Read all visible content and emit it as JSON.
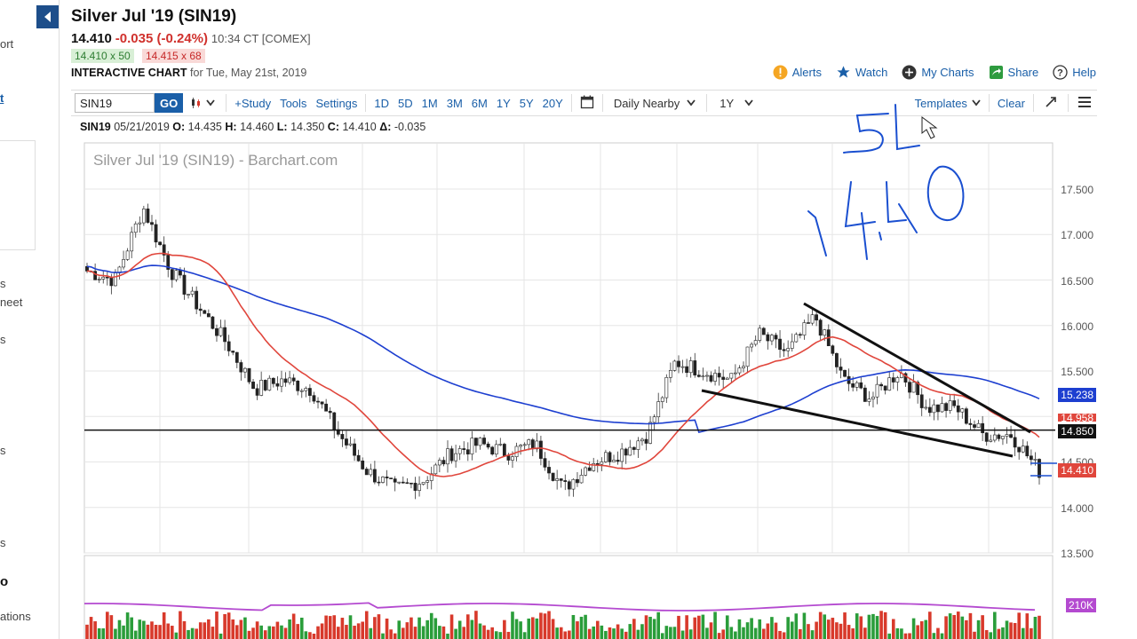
{
  "sidebar": {
    "fragments": [
      "ort",
      "t",
      "s",
      "neet",
      "s",
      "s",
      "s",
      "o",
      "ations"
    ]
  },
  "header": {
    "title": "Silver Jul '19 (SIN19)",
    "last": "14.410",
    "change": "-0.035 (-0.24%)",
    "time": "10:34 CT [COMEX]",
    "bid": "14.410 x 50",
    "ask": "14.415 x 68",
    "interactive_label": "INTERACTIVE CHART",
    "interactive_date": "for Tue, May 21st, 2019"
  },
  "actions": [
    {
      "label": "Alerts",
      "icon": "alert-icon"
    },
    {
      "label": "Watch",
      "icon": "star-icon"
    },
    {
      "label": "My Charts",
      "icon": "plus-circle-icon"
    },
    {
      "label": "Share",
      "icon": "share-icon"
    },
    {
      "label": "Help",
      "icon": "help-icon"
    }
  ],
  "toolbar": {
    "symbol_value": "SIN19",
    "go_label": "GO",
    "study_label": "+Study",
    "tools_label": "Tools",
    "settings_label": "Settings",
    "periods": [
      "1D",
      "5D",
      "1M",
      "3M",
      "6M",
      "1Y",
      "5Y",
      "20Y"
    ],
    "selected_period": "1Y",
    "contract_label": "Daily Nearby",
    "range_label": "1Y",
    "templates_label": "Templates",
    "clear_label": "Clear"
  },
  "ohlc": {
    "symbol": "SIN19",
    "date": "05/21/2019",
    "open_label": "O:",
    "open": "14.435",
    "high_label": "H:",
    "high": "14.460",
    "low_label": "L:",
    "low": "14.350",
    "close_label": "C:",
    "close": "14.410",
    "delta_label": "Δ:",
    "delta": "-0.035"
  },
  "chart": {
    "watermark": "Silver Jul '19 (SIN19) - Barchart.com",
    "y_ticks": [
      "17.500",
      "17.000",
      "16.500",
      "16.000",
      "15.500",
      "14.500",
      "14.000",
      "13.500"
    ],
    "badges": [
      {
        "label": "15.238",
        "color": "#1d3fd0"
      },
      {
        "label": "14.958",
        "color": "#e0463c"
      },
      {
        "label": "14.850",
        "color": "#111111"
      },
      {
        "label": "14.410",
        "color": "#e0463c"
      },
      {
        "label": "210K",
        "color": "#b44ad0"
      }
    ],
    "handwriting": [
      "5L",
      "14.40"
    ],
    "colors": {
      "up": "#2a9d3a",
      "down": "#d8392b",
      "ma_fast": "#e0463c",
      "ma_slow": "#1d3fd0",
      "volume_ma": "#b44ad0",
      "annotation_ink": "#1a4fd0"
    }
  },
  "chart_data": {
    "type": "candlestick",
    "title": "Silver Jul '19 (SIN19) - Barchart.com",
    "ylim": [
      13.5,
      17.6
    ],
    "y_ticks": [
      17.5,
      17.0,
      16.5,
      16.0,
      15.5,
      14.5,
      14.0,
      13.5
    ],
    "close_path_approx": [
      16.6,
      16.5,
      17.3,
      16.6,
      16.2,
      15.8,
      15.3,
      15.4,
      15.3,
      14.8,
      14.4,
      14.2,
      14.3,
      14.6,
      14.7,
      14.6,
      14.7,
      14.2,
      14.5,
      14.6,
      14.8,
      15.6,
      15.5,
      15.4,
      15.9,
      15.7,
      16.1,
      15.4,
      15.2,
      15.5,
      15.1,
      15.1,
      14.8,
      14.8,
      14.4
    ],
    "ma_slow_last": 15.238,
    "ma_fast_last": 14.958,
    "horizontal_line": 14.85,
    "last": 14.41,
    "volume_ma_last": "210K"
  }
}
